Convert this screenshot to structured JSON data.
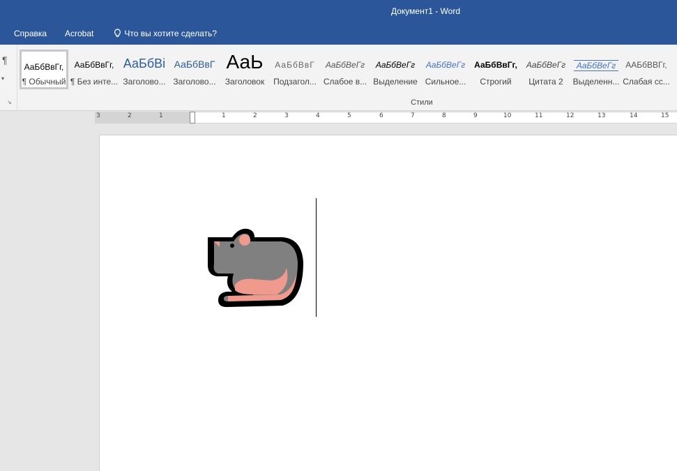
{
  "window": {
    "title": "Документ1  -  Word"
  },
  "menu": {
    "help": "Справка",
    "acrobat": "Acrobat",
    "tell_me": "Что вы хотите сделать?"
  },
  "ribbon": {
    "group_label": "Стили",
    "styles": [
      {
        "sample": "АаБбВвГг,",
        "label": "¶ Обычный"
      },
      {
        "sample": "АаБбВвГг,",
        "label": "¶ Без инте..."
      },
      {
        "sample": "АаБбВі",
        "label": "Заголово..."
      },
      {
        "sample": "АаБбВвГ",
        "label": "Заголово..."
      },
      {
        "sample": "АаЬ",
        "label": "Заголовок"
      },
      {
        "sample": "АаБбВвГ",
        "label": "Подзагол..."
      },
      {
        "sample": "АаБбВеГг",
        "label": "Слабое в..."
      },
      {
        "sample": "АаБбВеГг",
        "label": "Выделение"
      },
      {
        "sample": "АаБбВеГг",
        "label": "Сильное..."
      },
      {
        "sample": "АаБбВвГг,",
        "label": "Строгий"
      },
      {
        "sample": "АаБбВеГг",
        "label": "Цитата 2"
      },
      {
        "sample": "АаБбВеГг",
        "label": "Выделенн..."
      },
      {
        "sample": "ААБбВВГг,",
        "label": "Слабая сс..."
      }
    ]
  },
  "ruler": {
    "left": [
      "3",
      "2",
      "1"
    ],
    "right": [
      "1",
      "2",
      "3",
      "4",
      "5",
      "6",
      "7",
      "8",
      "9",
      "10",
      "11",
      "12",
      "13",
      "14",
      "15"
    ]
  },
  "document": {
    "content": "rat emoji image",
    "cursor_visible": true
  },
  "colors": {
    "titlebar": "#2b579a",
    "rat_body": "#808080",
    "rat_accent": "#f09a8e"
  }
}
